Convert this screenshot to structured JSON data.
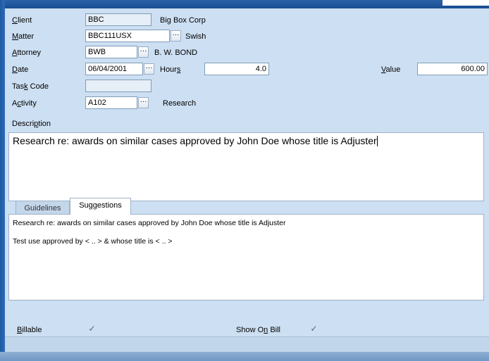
{
  "form": {
    "client": {
      "label": "Client",
      "code": "BBC",
      "name": "Big Box Corp"
    },
    "matter": {
      "label": "Matter",
      "code": "BBC111USX",
      "name": "Swish"
    },
    "attorney": {
      "label": "Attorney",
      "code": "BWB",
      "name": "B. W. BOND"
    },
    "date": {
      "label": "Date",
      "value": "06/04/2001"
    },
    "hours": {
      "label": "Hours",
      "value": "4.0"
    },
    "value": {
      "label": "Value",
      "amount": "600.00"
    },
    "task_code": {
      "label": "Task Code",
      "value": ""
    },
    "activity": {
      "label": "Activity",
      "code": "A102",
      "name": "Research"
    },
    "description": {
      "label": "Description",
      "text": "Research re: awards on similar cases approved by John Doe whose title is Adjuster"
    },
    "ellipsis": "···"
  },
  "tabs": {
    "guidelines": "Guidelines",
    "suggestions": "Suggestions",
    "active": "Suggestions",
    "suggestion_lines": [
      "Research re: awards on similar cases approved by John Doe whose title is Adjuster",
      "Test use approved by < .. > & whose title is < .. >"
    ]
  },
  "footer": {
    "billable": {
      "label": "Billable",
      "checked": true,
      "mark": "✓"
    },
    "show_on_bill": {
      "label": "Show On Bill",
      "checked": true,
      "mark": "✓"
    }
  }
}
